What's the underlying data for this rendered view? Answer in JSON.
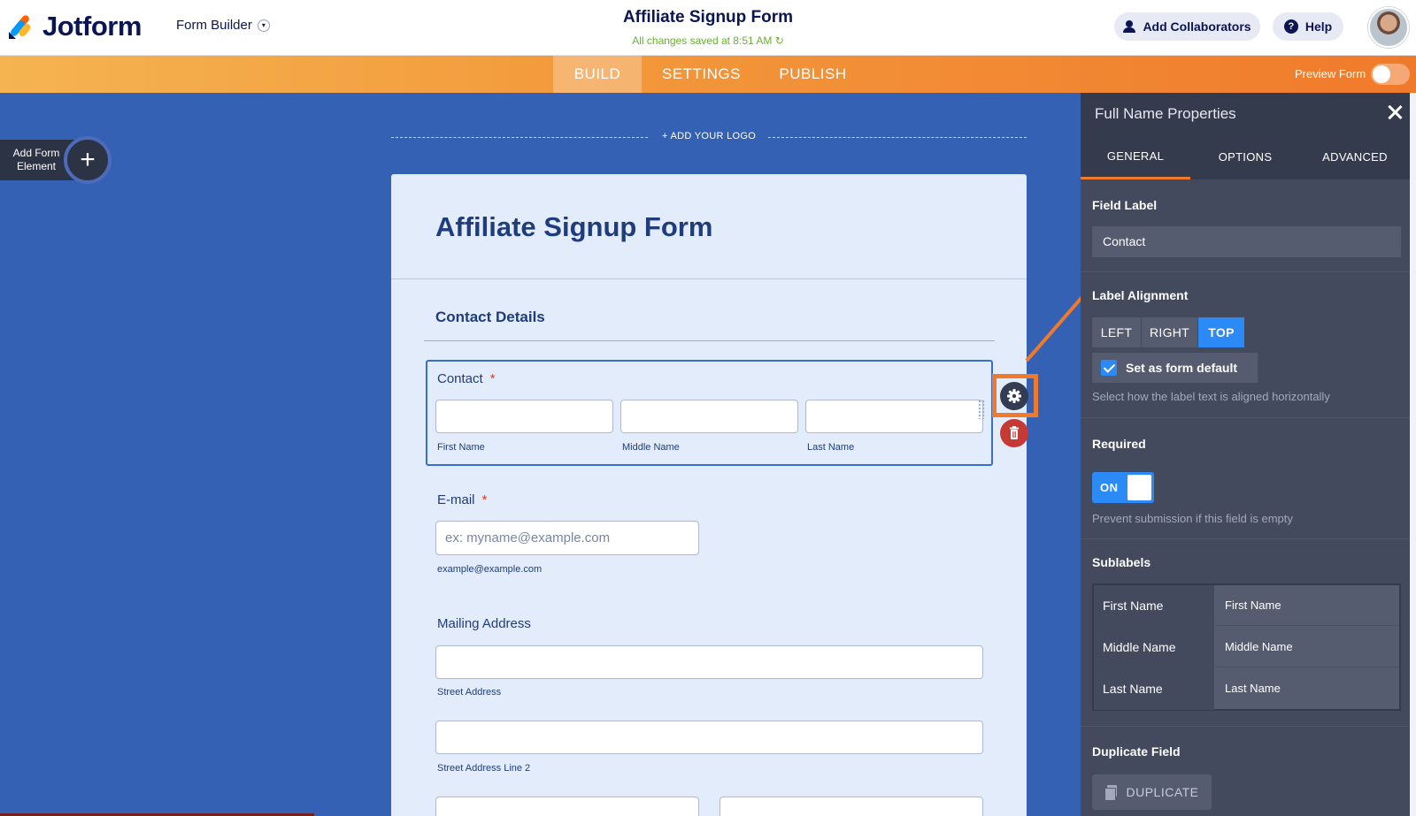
{
  "header": {
    "brand": "Jotform",
    "mode_label": "Form Builder",
    "form_title": "Affiliate Signup Form",
    "saved_status": "All changes saved at 8:51 AM",
    "collab_label": "Add Collaborators",
    "help_label": "Help"
  },
  "nav": {
    "tabs": [
      {
        "label": "BUILD",
        "active": true
      },
      {
        "label": "SETTINGS",
        "active": false
      },
      {
        "label": "PUBLISH",
        "active": false
      }
    ],
    "preview_label": "Preview Form"
  },
  "canvas": {
    "add_element_label": "Add Form Element",
    "add_logo": "+ ADD YOUR LOGO",
    "form": {
      "title": "Affiliate Signup Form",
      "section": "Contact Details",
      "contact": {
        "label": "Contact",
        "required_mark": "*",
        "sublabels": [
          "First Name",
          "Middle Name",
          "Last Name"
        ]
      },
      "email": {
        "label": "E-mail",
        "required_mark": "*",
        "placeholder": "ex: myname@example.com",
        "sublabel": "example@example.com"
      },
      "address": {
        "label": "Mailing Address",
        "street": "Street Address",
        "street2": "Street Address Line 2"
      }
    }
  },
  "panel": {
    "title": "Full Name Properties",
    "tabs": [
      {
        "label": "GENERAL",
        "active": true
      },
      {
        "label": "OPTIONS",
        "active": false
      },
      {
        "label": "ADVANCED",
        "active": false
      }
    ],
    "field_label_title": "Field Label",
    "field_label_value": "Contact",
    "alignment_title": "Label Alignment",
    "alignment_options": [
      "LEFT",
      "RIGHT",
      "TOP"
    ],
    "alignment_selected": "TOP",
    "default_label": "Set as form default",
    "alignment_help": "Select how the label text is aligned horizontally",
    "required_title": "Required",
    "required_state": "ON",
    "required_help": "Prevent submission if this field is empty",
    "sublabels_title": "Sublabels",
    "sublabels": [
      {
        "key": "First Name",
        "value": "First Name"
      },
      {
        "key": "Middle Name",
        "value": "Middle Name"
      },
      {
        "key": "Last Name",
        "value": "Last Name"
      }
    ],
    "duplicate_title": "Duplicate Field",
    "duplicate_label": "DUPLICATE"
  },
  "colors": {
    "canvas_bg": "#3461b3",
    "accent_orange": "#f07a2b",
    "panel_bg": "#434a5e",
    "active_blue": "#2b8af5",
    "brand_navy": "#0a1551"
  }
}
